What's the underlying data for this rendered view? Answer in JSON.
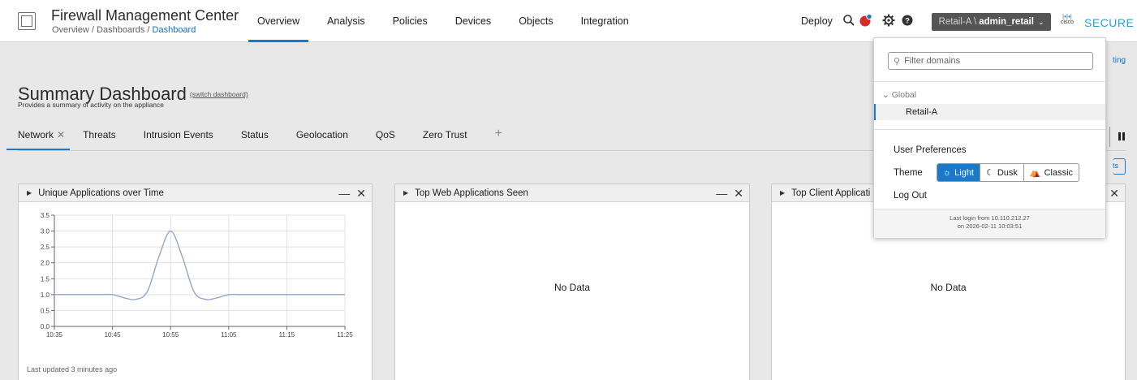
{
  "header": {
    "app_title": "Firewall Management Center",
    "breadcrumb": {
      "part1": "Overview",
      "sep": " / ",
      "part2": "Dashboards",
      "part3": "Dashboard"
    },
    "nav": [
      {
        "label": "Overview"
      },
      {
        "label": "Analysis"
      },
      {
        "label": "Policies"
      },
      {
        "label": "Devices"
      },
      {
        "label": "Objects"
      },
      {
        "label": "Integration"
      }
    ],
    "deploy_label": "Deploy",
    "user": {
      "domain": "Retail-A \\",
      "name": "admin_retail"
    },
    "brand": {
      "cisco": "cisco",
      "secure": "SECURE"
    },
    "alert_badge_color": "#d62b2b"
  },
  "dashboard": {
    "title": "Summary Dashboard",
    "switch_link": "(switch dashboard)",
    "subtitle": "Provides a summary of activity on the appliance",
    "tabs": [
      {
        "label": "Network"
      },
      {
        "label": "Threats"
      },
      {
        "label": "Intrusion Events"
      },
      {
        "label": "Status"
      },
      {
        "label": "Geolocation"
      },
      {
        "label": "QoS"
      },
      {
        "label": "Zero Trust"
      }
    ],
    "partial_link": "ting",
    "partial_button": "ts"
  },
  "widgets": [
    {
      "title": "Unique Applications over Time",
      "last_updated": "Last updated 3 minutes ago"
    },
    {
      "title": "Top Web Applications Seen",
      "body": "No Data"
    },
    {
      "title": "Top Client Applicati",
      "body": "No Data"
    }
  ],
  "chart_data": {
    "type": "line",
    "x": [
      "10:35",
      "10:37",
      "10:39",
      "10:41",
      "10:43",
      "10:45",
      "10:47",
      "10:49",
      "10:51",
      "10:53",
      "10:55",
      "10:57",
      "10:59",
      "11:01",
      "11:03",
      "11:05",
      "11:07",
      "11:09",
      "11:11",
      "11:13",
      "11:15",
      "11:17",
      "11:19",
      "11:21",
      "11:23",
      "11:25"
    ],
    "series": [
      {
        "values": [
          1.0,
          1.0,
          1.0,
          1.0,
          1.0,
          1.0,
          0.9,
          0.85,
          1.1,
          2.2,
          3.0,
          2.2,
          1.1,
          0.85,
          0.9,
          1.0,
          1.0,
          1.0,
          1.0,
          1.0,
          1.0,
          1.0,
          1.0,
          1.0,
          1.0,
          1.0
        ]
      }
    ],
    "xticks": [
      "10:35",
      "10:45",
      "10:55",
      "11:05",
      "11:15",
      "11:25"
    ],
    "yticks": [
      "0.0",
      "0.5",
      "1.0",
      "1.5",
      "2.0",
      "2.5",
      "3.0",
      "3.5"
    ],
    "ylim": [
      0,
      3.5
    ],
    "grid": true,
    "line_color": "#8fa7c9"
  },
  "dropdown": {
    "filter_placeholder": "Filter domains",
    "global_label": "Global",
    "domain_selected": "Retail-A",
    "user_preferences": "User Preferences",
    "theme_label": "Theme",
    "themes": [
      {
        "label": "Light",
        "selected": true
      },
      {
        "label": "Dusk",
        "selected": false
      },
      {
        "label": "Classic",
        "selected": false
      }
    ],
    "logout": "Log Out",
    "last_login_line1": "Last login from 10.110.212.27",
    "last_login_line2": "on 2026-02-11 10:03:51"
  }
}
